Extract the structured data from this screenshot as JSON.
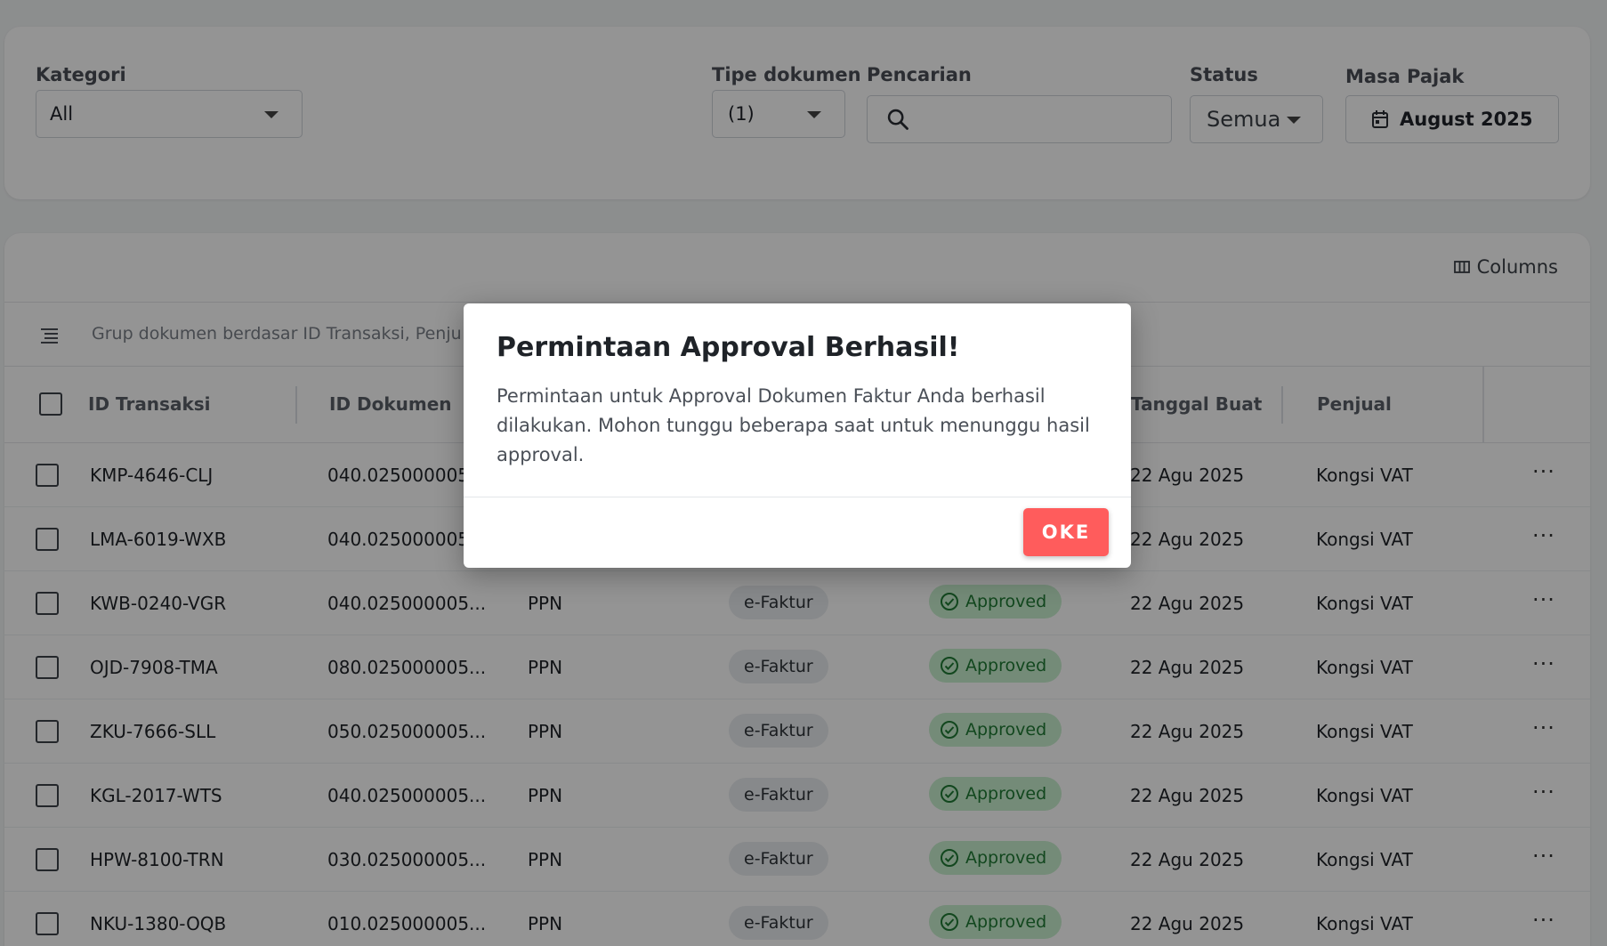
{
  "filters": {
    "kategori_label": "Kategori",
    "kategori_value": "All",
    "tipe_label": "Tipe dokumen",
    "tipe_value": "(1)",
    "pencarian_label": "Pencarian",
    "pencarian_value": "",
    "status_label": "Status",
    "status_value": "Semua",
    "masa_label": "Masa Pajak",
    "masa_value": "August 2025"
  },
  "toolbar": {
    "columns_label": "Columns"
  },
  "group": {
    "text": "Grup dokumen berdasar ID Transaksi, Penju"
  },
  "table": {
    "headers": [
      "ID Transaksi",
      "ID Dokumen",
      "Tanggal Buat",
      "Penjual"
    ],
    "rows": [
      {
        "id": "KMP-4646-CLJ",
        "doc": "040.025000005...",
        "tax": "",
        "type": "",
        "status": "",
        "date": "22 Agu 2025",
        "seller": "Kongsi VAT"
      },
      {
        "id": "LMA-6019-WXB",
        "doc": "040.025000005...",
        "tax": "",
        "type": "",
        "status": "",
        "date": "22 Agu 2025",
        "seller": "Kongsi VAT"
      },
      {
        "id": "KWB-0240-VGR",
        "doc": "040.025000005...",
        "tax": "PPN",
        "type": "e-Faktur",
        "status": "Approved",
        "date": "22 Agu 2025",
        "seller": "Kongsi VAT"
      },
      {
        "id": "OJD-7908-TMA",
        "doc": "080.025000005...",
        "tax": "PPN",
        "type": "e-Faktur",
        "status": "Approved",
        "date": "22 Agu 2025",
        "seller": "Kongsi VAT"
      },
      {
        "id": "ZKU-7666-SLL",
        "doc": "050.025000005...",
        "tax": "PPN",
        "type": "e-Faktur",
        "status": "Approved",
        "date": "22 Agu 2025",
        "seller": "Kongsi VAT"
      },
      {
        "id": "KGL-2017-WTS",
        "doc": "040.025000005...",
        "tax": "PPN",
        "type": "e-Faktur",
        "status": "Approved",
        "date": "22 Agu 2025",
        "seller": "Kongsi VAT"
      },
      {
        "id": "HPW-8100-TRN",
        "doc": "030.025000005...",
        "tax": "PPN",
        "type": "e-Faktur",
        "status": "Approved",
        "date": "22 Agu 2025",
        "seller": "Kongsi VAT"
      },
      {
        "id": "NKU-1380-OQB",
        "doc": "010.025000005...",
        "tax": "PPN",
        "type": "e-Faktur",
        "status": "Approved",
        "date": "22 Agu 2025",
        "seller": "Kongsi VAT"
      }
    ]
  },
  "modal": {
    "title": "Permintaan Approval Berhasil!",
    "body": "Permintaan untuk Approval Dokumen Faktur Anda berhasil dilakukan. Mohon tunggu beberapa saat untuk menunggu hasil approval.",
    "ok_label": "OKE"
  },
  "colors": {
    "accent": "#ff5c5c",
    "approved_bg": "#c9f0cf",
    "approved_text": "#1f7a35"
  },
  "icons": [
    "chevron-down-icon",
    "search-icon",
    "calendar-icon",
    "columns-icon",
    "group-list-icon",
    "checkbox-icon",
    "check-circle-icon",
    "more-icon"
  ]
}
